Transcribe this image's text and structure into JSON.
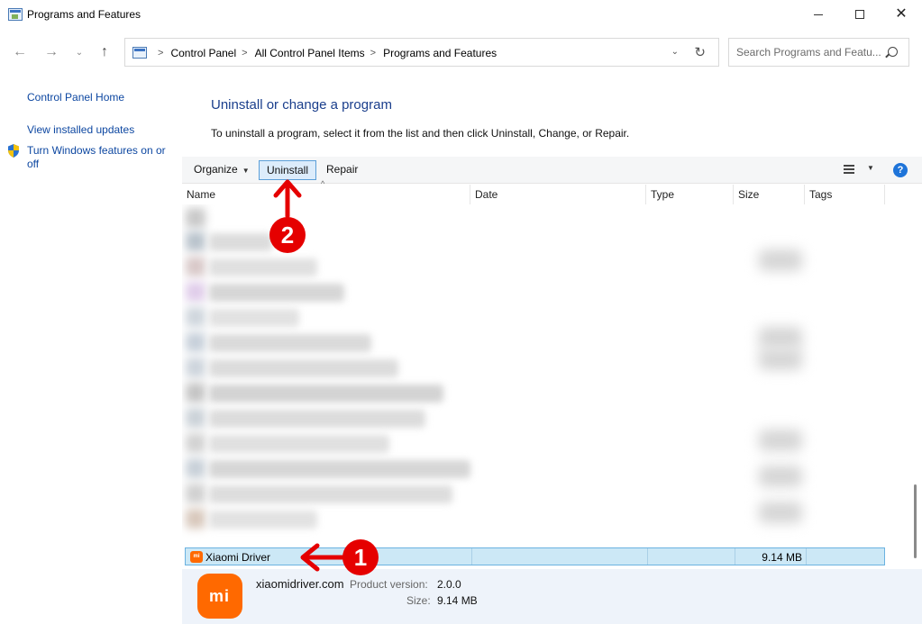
{
  "window": {
    "title": "Programs and Features",
    "minimize_glyph": "",
    "maximize_glyph": "",
    "close_glyph": "✕"
  },
  "nav": {
    "back_glyph": "←",
    "forward_glyph": "→",
    "recent_glyph": "⌄",
    "up_glyph": "↑",
    "breadcrumb": [
      "Control Panel",
      "All Control Panel Items",
      "Programs and Features"
    ],
    "separator": ">",
    "refresh_glyph": "↻",
    "dropdown_glyph": "⌄"
  },
  "search": {
    "placeholder": "Search Programs and Featu..."
  },
  "sidebar": {
    "home": "Control Panel Home",
    "updates": "View installed updates",
    "features": "Turn Windows features on or off"
  },
  "main": {
    "heading": "Uninstall or change a program",
    "subtext": "To uninstall a program, select it from the list and then click Uninstall, Change, or Repair."
  },
  "toolbar": {
    "organize": "Organize",
    "uninstall": "Uninstall",
    "repair": "Repair",
    "help": "?"
  },
  "columns": {
    "name": "Name",
    "date": "Date",
    "type": "Type",
    "size": "Size",
    "tags": "Tags"
  },
  "selected_program": {
    "name": "Xiaomi Driver",
    "size": "9.14 MB",
    "icon_text": "mi"
  },
  "details": {
    "publisher": "xiaomidriver.com",
    "version_label": "Product version:",
    "version": "2.0.0",
    "size_label": "Size:",
    "size": "9.14 MB",
    "logo_text": "mi"
  },
  "annotations": {
    "step1": "1",
    "step2": "2",
    "color": "#e50000"
  },
  "colors": {
    "accent_blue": "#1a3e8c",
    "link_blue": "#0d47a1",
    "selection": "#cce8f6",
    "xiaomi_orange": "#ff6900"
  }
}
